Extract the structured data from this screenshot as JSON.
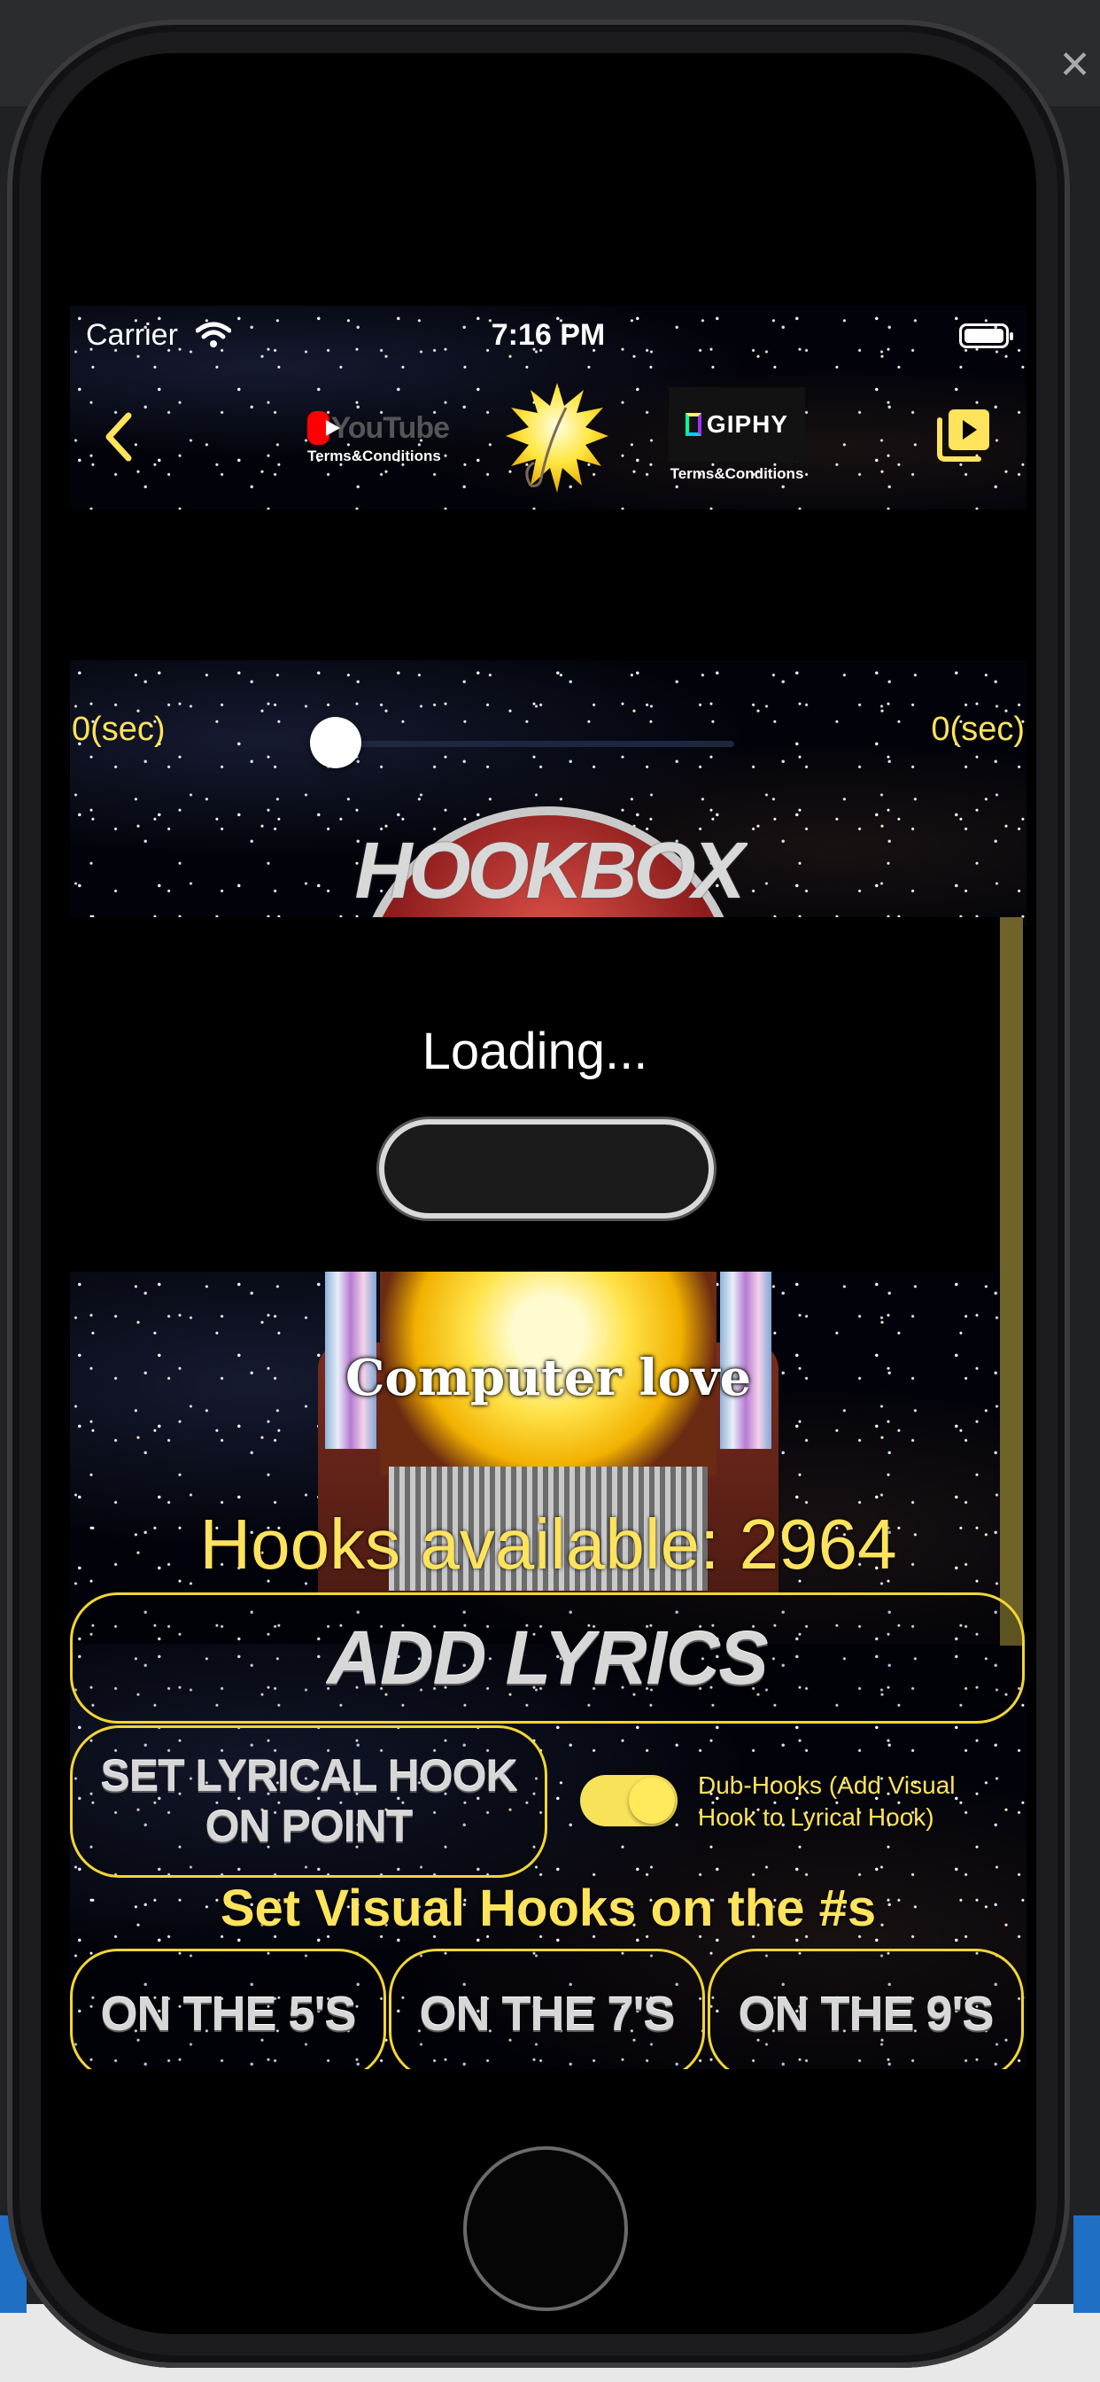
{
  "status_bar": {
    "carrier": "Carrier",
    "time": "7:16 PM"
  },
  "nav": {
    "youtube_word": "YouTube",
    "youtube_terms": "Terms&Conditions",
    "giphy_word": "GIPHY",
    "giphy_terms": "Terms&Conditions"
  },
  "player": {
    "time_left": "0(sec)",
    "time_right": "0(sec)",
    "progress_fraction": 0.0
  },
  "jukebox_title": "HOOKBOX",
  "loading": {
    "text": "Loading..."
  },
  "song": {
    "title": "Computer love"
  },
  "hooks": {
    "available_text": "Hooks available: 2964"
  },
  "buttons": {
    "add_lyrics": "ADD LYRICS",
    "set_hook_line1": "SET LYRICAL HOOK",
    "set_hook_line2": "ON POINT",
    "on_5": "ON THE 5'S",
    "on_7": "ON THE 7'S",
    "on_9": "ON THE 9'S"
  },
  "dub_hooks": {
    "label": "Dub-Hooks (Add Visual Hook to Lyrical Hook)",
    "enabled": true
  },
  "visual_heading": "Set Visual Hooks on the #s",
  "icons": {
    "back": "chevron-left-icon",
    "playlist": "playlist-icon",
    "wifi": "wifi-icon",
    "battery": "battery-icon",
    "logo": "sun-logo-icon"
  },
  "colors": {
    "accent_yellow": "#ffe35c",
    "button_border": "#f2d634",
    "background": "#000000"
  }
}
